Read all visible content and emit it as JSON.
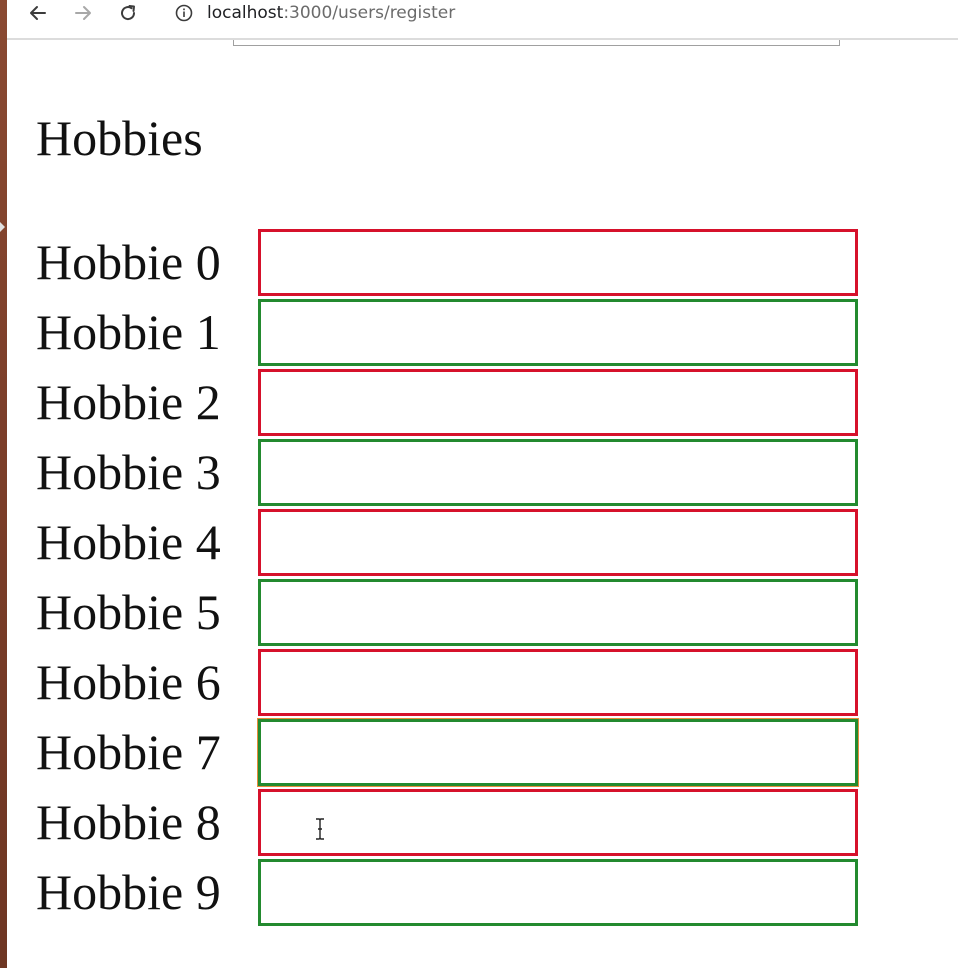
{
  "browser": {
    "url_host": "localhost",
    "url_path": ":3000/users/register",
    "back_icon": "back-arrow-icon",
    "forward_icon": "forward-arrow-icon",
    "reload_icon": "reload-icon",
    "info_icon": "info-icon"
  },
  "form": {
    "section_title": "Hobbies",
    "hobbies": [
      {
        "label": "Hobbie 0",
        "value": "",
        "state": "invalid"
      },
      {
        "label": "Hobbie 1",
        "value": "",
        "state": "valid"
      },
      {
        "label": "Hobbie 2",
        "value": "",
        "state": "invalid"
      },
      {
        "label": "Hobbie 3",
        "value": "",
        "state": "valid"
      },
      {
        "label": "Hobbie 4",
        "value": "",
        "state": "invalid"
      },
      {
        "label": "Hobbie 5",
        "value": "",
        "state": "valid"
      },
      {
        "label": "Hobbie 6",
        "value": "",
        "state": "invalid"
      },
      {
        "label": "Hobbie 7",
        "value": "",
        "state": "valid",
        "focused": true
      },
      {
        "label": "Hobbie 8",
        "value": "",
        "state": "invalid"
      },
      {
        "label": "Hobbie 9",
        "value": "",
        "state": "valid"
      }
    ]
  },
  "colors": {
    "invalid_border": "#d6112b",
    "valid_border": "#238a2f",
    "focus_ring": "#e58b3a"
  }
}
